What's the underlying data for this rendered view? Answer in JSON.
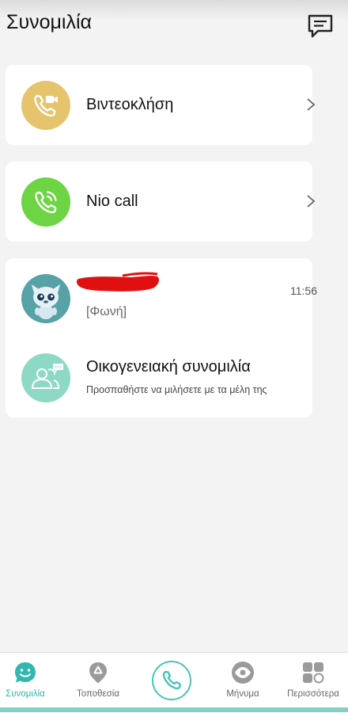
{
  "header": {
    "title": "Συνομιλία",
    "chat_icon": "chat-bubble-icon"
  },
  "call_options": [
    {
      "label": "Βιντεοκλήση",
      "icon": "video-call-icon",
      "color": "#e6c46e"
    },
    {
      "label": "Nio call",
      "icon": "phone-call-icon",
      "color": "#6dd443"
    }
  ],
  "conversations": {
    "contact": {
      "last_message": "[Φωνή]",
      "time": "11:56"
    },
    "family": {
      "title": "Οικογενειακή συνομιλία",
      "subtitle": "Προσπαθήστε να μιλήσετε με τα μέλη της",
      "icon_color": "#8dd9c5"
    }
  },
  "tabbar": {
    "items": [
      {
        "label": "Συνομιλία",
        "icon": "chat-smile-icon",
        "active": true
      },
      {
        "label": "Τοποθεσία",
        "icon": "location-pin-icon",
        "active": false
      },
      {
        "label": "",
        "icon": "phone-icon",
        "active": false
      },
      {
        "label": "Μήνυμα",
        "icon": "eye-icon",
        "active": false
      },
      {
        "label": "Περισσότερα",
        "icon": "grid-icon",
        "active": false
      }
    ],
    "accent": "#2fb3a9"
  }
}
